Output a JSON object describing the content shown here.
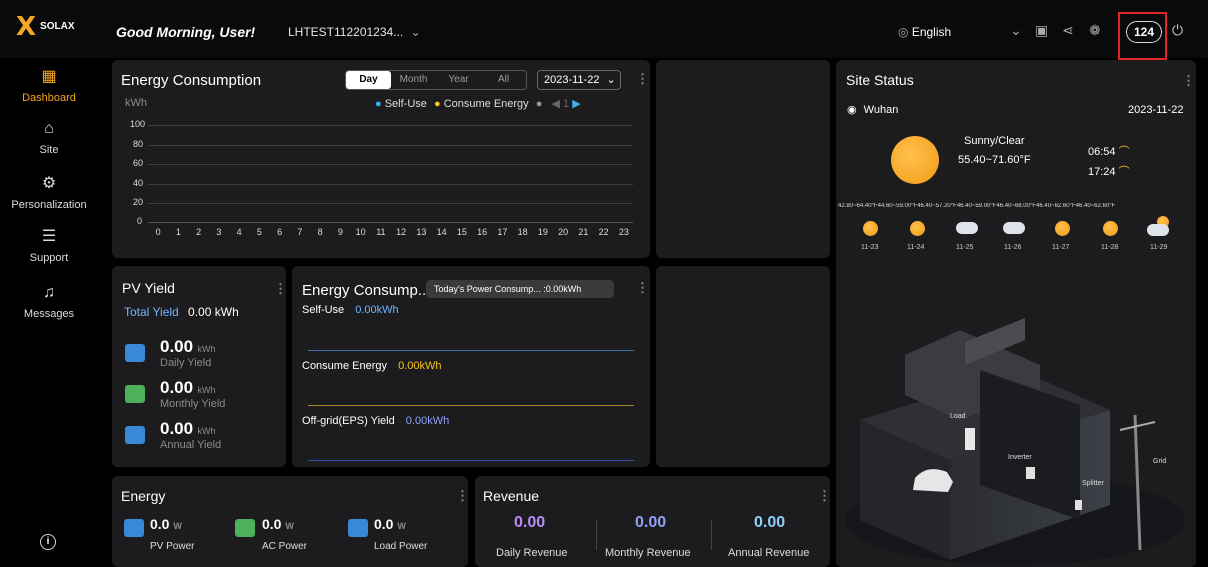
{
  "header": {
    "logo_text": "SOLAX",
    "greeting": "Good Morning, User!",
    "plant_selector": "LHTEST112201234...",
    "language": "English",
    "message_count": "124"
  },
  "sidebar": {
    "items": [
      {
        "label": "Dashboard",
        "icon": "dashboard-icon"
      },
      {
        "label": "Site",
        "icon": "home-icon"
      },
      {
        "label": "Personalization",
        "icon": "settings-icon"
      },
      {
        "label": "Support",
        "icon": "support-icon"
      },
      {
        "label": "Messages",
        "icon": "bell-icon"
      }
    ],
    "info_icon": "info-icon"
  },
  "energy_consumption": {
    "title": "Energy Consumption",
    "periods": [
      "Day",
      "Month",
      "Year",
      "All"
    ],
    "active_period": "Day",
    "date": "2023-11-22",
    "unit": "kWh",
    "legend": [
      "Self-Use",
      "Consume Energy"
    ],
    "page": "1",
    "colors": {
      "self_use": "#3db1f0",
      "consume": "#f5c51a"
    }
  },
  "chart_data": {
    "type": "line",
    "ylabel": "kWh",
    "ylim": [
      0,
      100
    ],
    "yticks": [
      "100",
      "80",
      "60",
      "40",
      "20",
      "0"
    ],
    "x": [
      "0",
      "1",
      "2",
      "3",
      "4",
      "5",
      "6",
      "7",
      "8",
      "9",
      "10",
      "11",
      "12",
      "13",
      "14",
      "15",
      "16",
      "17",
      "18",
      "19",
      "20",
      "21",
      "22",
      "23"
    ],
    "series": [
      {
        "name": "Self-Use",
        "values": [
          0,
          0,
          0,
          0,
          0,
          0,
          0,
          0,
          0,
          0,
          0,
          0,
          0,
          0,
          0,
          0,
          0,
          0,
          0,
          0,
          0,
          0,
          0,
          0
        ]
      },
      {
        "name": "Consume Energy",
        "values": [
          0,
          0,
          0,
          0,
          0,
          0,
          0,
          0,
          0,
          0,
          0,
          0,
          0,
          0,
          0,
          0,
          0,
          0,
          0,
          0,
          0,
          0,
          0,
          0
        ]
      }
    ]
  },
  "pv_yield": {
    "title": "PV Yield",
    "total_label": "Total Yield",
    "total_value": "0.00 kWh",
    "items": [
      {
        "value": "0.00",
        "unit": "kWh",
        "label": "Daily Yield"
      },
      {
        "value": "0.00",
        "unit": "kWh",
        "label": "Monthly Yield"
      },
      {
        "value": "0.00",
        "unit": "kWh",
        "label": "Annual Yield"
      }
    ]
  },
  "energy_breakdown": {
    "title": "Energy Consump...",
    "tooltip": "Today's Power Consump... :0.00kWh",
    "rows": [
      {
        "label": "Self-Use",
        "value": "0.00kWh"
      },
      {
        "label": "Consume Energy",
        "value": "0.00kWh"
      },
      {
        "label": "Off-grid(EPS) Yield",
        "value": "0.00kWh"
      }
    ]
  },
  "energy": {
    "title": "Energy",
    "items": [
      {
        "value": "0.0",
        "unit": "W",
        "label": "PV Power"
      },
      {
        "value": "0.0",
        "unit": "W",
        "label": "AC Power"
      },
      {
        "value": "0.0",
        "unit": "W",
        "label": "Load Power"
      }
    ]
  },
  "revenue": {
    "title": "Revenue",
    "items": [
      {
        "value": "0.00",
        "label": "Daily Revenue",
        "color": "#b98cf5"
      },
      {
        "value": "0.00",
        "label": "Monthly Revenue",
        "color": "#8fa0f8"
      },
      {
        "value": "0.00",
        "label": "Annual Revenue",
        "color": "#8fd0f8"
      }
    ]
  },
  "site_status": {
    "title": "Site Status",
    "location": "Wuhan",
    "date": "2023-11-22",
    "weather": "Sunny/Clear",
    "temp": "55.40~71.60°F",
    "sunrise": "06:54",
    "sunset": "17:24",
    "forecast": [
      {
        "date": "11-23",
        "temp": "42.80~64.40°F",
        "icon": "sun"
      },
      {
        "date": "11-24",
        "temp": "44.60~59.00°F",
        "icon": "sun"
      },
      {
        "date": "11-25",
        "temp": "46.40~57.20°F",
        "icon": "cloud"
      },
      {
        "date": "11-26",
        "temp": "46.40~59.00°F",
        "icon": "cloud"
      },
      {
        "date": "11-27",
        "temp": "46.40~68.00°F",
        "icon": "sun"
      },
      {
        "date": "11-28",
        "temp": "46.40~62.60°F",
        "icon": "sun"
      },
      {
        "date": "11-29",
        "temp": "46.40~62.60°F",
        "icon": "partly-cloudy"
      }
    ],
    "diagram_labels": {
      "load": "Load",
      "inverter": "Inverter",
      "splitter": "Splitter",
      "grid": "Grid"
    }
  }
}
